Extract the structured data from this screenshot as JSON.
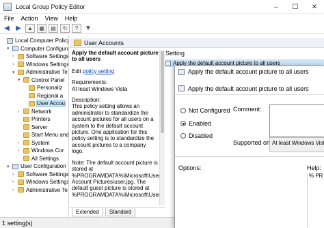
{
  "window": {
    "title": "Local Group Policy Editor",
    "controls": [
      "–",
      "☐",
      "✕"
    ]
  },
  "menu": [
    "File",
    "Action",
    "View",
    "Help"
  ],
  "toolbar": {
    "buttons": [
      "back-icon",
      "forward-icon",
      "folder-up-icon",
      "show-hide-tree-icon",
      "properties-icon",
      "refresh-icon",
      "help-icon",
      "filter-icon"
    ]
  },
  "tree": [
    {
      "label": "Local Computer Policy",
      "icon": "computer-policy-icon",
      "expander": "",
      "indent": 0
    },
    {
      "label": "Computer Configura",
      "icon": "computer-config-icon",
      "expander": "▾",
      "indent": 1
    },
    {
      "label": "Software Settings",
      "icon": "folder-icon",
      "expander": "›",
      "indent": 2
    },
    {
      "label": "Windows Settings",
      "icon": "folder-icon",
      "expander": "›",
      "indent": 2
    },
    {
      "label": "Administrative Te",
      "icon": "folder-icon",
      "expander": "▾",
      "indent": 2
    },
    {
      "label": "Control Panel",
      "icon": "folder-icon",
      "expander": "▾",
      "indent": 3
    },
    {
      "label": "Personaliz",
      "icon": "folder-icon",
      "expander": "",
      "indent": 4
    },
    {
      "label": "Regional a",
      "icon": "folder-icon",
      "expander": "",
      "indent": 4
    },
    {
      "label": "User Accou",
      "icon": "folder-icon",
      "expander": "",
      "indent": 4,
      "selected": true
    },
    {
      "label": "Network",
      "icon": "folder-icon",
      "expander": "›",
      "indent": 3
    },
    {
      "label": "Printers",
      "icon": "folder-icon",
      "expander": "",
      "indent": 3
    },
    {
      "label": "Server",
      "icon": "folder-icon",
      "expander": "",
      "indent": 3
    },
    {
      "label": "Start Menu and",
      "icon": "folder-icon",
      "expander": "",
      "indent": 3
    },
    {
      "label": "System",
      "icon": "folder-icon",
      "expander": "›",
      "indent": 3
    },
    {
      "label": "Windows Cor",
      "icon": "folder-icon",
      "expander": "›",
      "indent": 3
    },
    {
      "label": "All Settings",
      "icon": "folder-icon",
      "expander": "",
      "indent": 3
    },
    {
      "label": "User Configuration",
      "icon": "user-config-icon",
      "expander": "▾",
      "indent": 1
    },
    {
      "label": "Software Settings",
      "icon": "folder-icon",
      "expander": "›",
      "indent": 2
    },
    {
      "label": "Windows Settings",
      "icon": "folder-icon",
      "expander": "›",
      "indent": 2
    },
    {
      "label": "Administrative Te",
      "icon": "folder-icon",
      "expander": "›",
      "indent": 2
    }
  ],
  "right_pane": {
    "header": "User Accounts",
    "policy_title": "Apply the default account picture to all users",
    "edit_prefix": "Edit",
    "edit_link": "policy setting",
    "requirements_label": "Requirements:",
    "requirements_value": "At least Windows Vista",
    "description_label": "Description:",
    "description_text": "This policy setting allows an administrator to standardize the account pictures for all users on a system to the default account picture. One application for this policy setting is to standardize the account pictures to a company logo.",
    "note_text": "Note: The default account picture is stored at %PROGRAMDATA%\\Microsoft\\User Account Pictures\\user.jpg. The default guest picture is stored at %PROGRAMDATA%\\Microsoft\\User",
    "column_setting": "Setting",
    "list_item": "Apply the default account picture to all users",
    "tabs": [
      "Extended",
      "Standard"
    ]
  },
  "dialog": {
    "title": "Apply the default account picture to all users",
    "header_title": "Apply the default account picture to all users",
    "radio_not_configured": "Not Configured",
    "radio_enabled": "Enabled",
    "radio_disabled": "Disabled",
    "selected": "Enabled",
    "comment_label": "Comment:",
    "supported_label": "Supported on:",
    "supported_value": "At least Windows Vista",
    "options_label": "Options:",
    "help_label": "Help:",
    "help_text": "% PR"
  },
  "status": "1 setting(s)"
}
